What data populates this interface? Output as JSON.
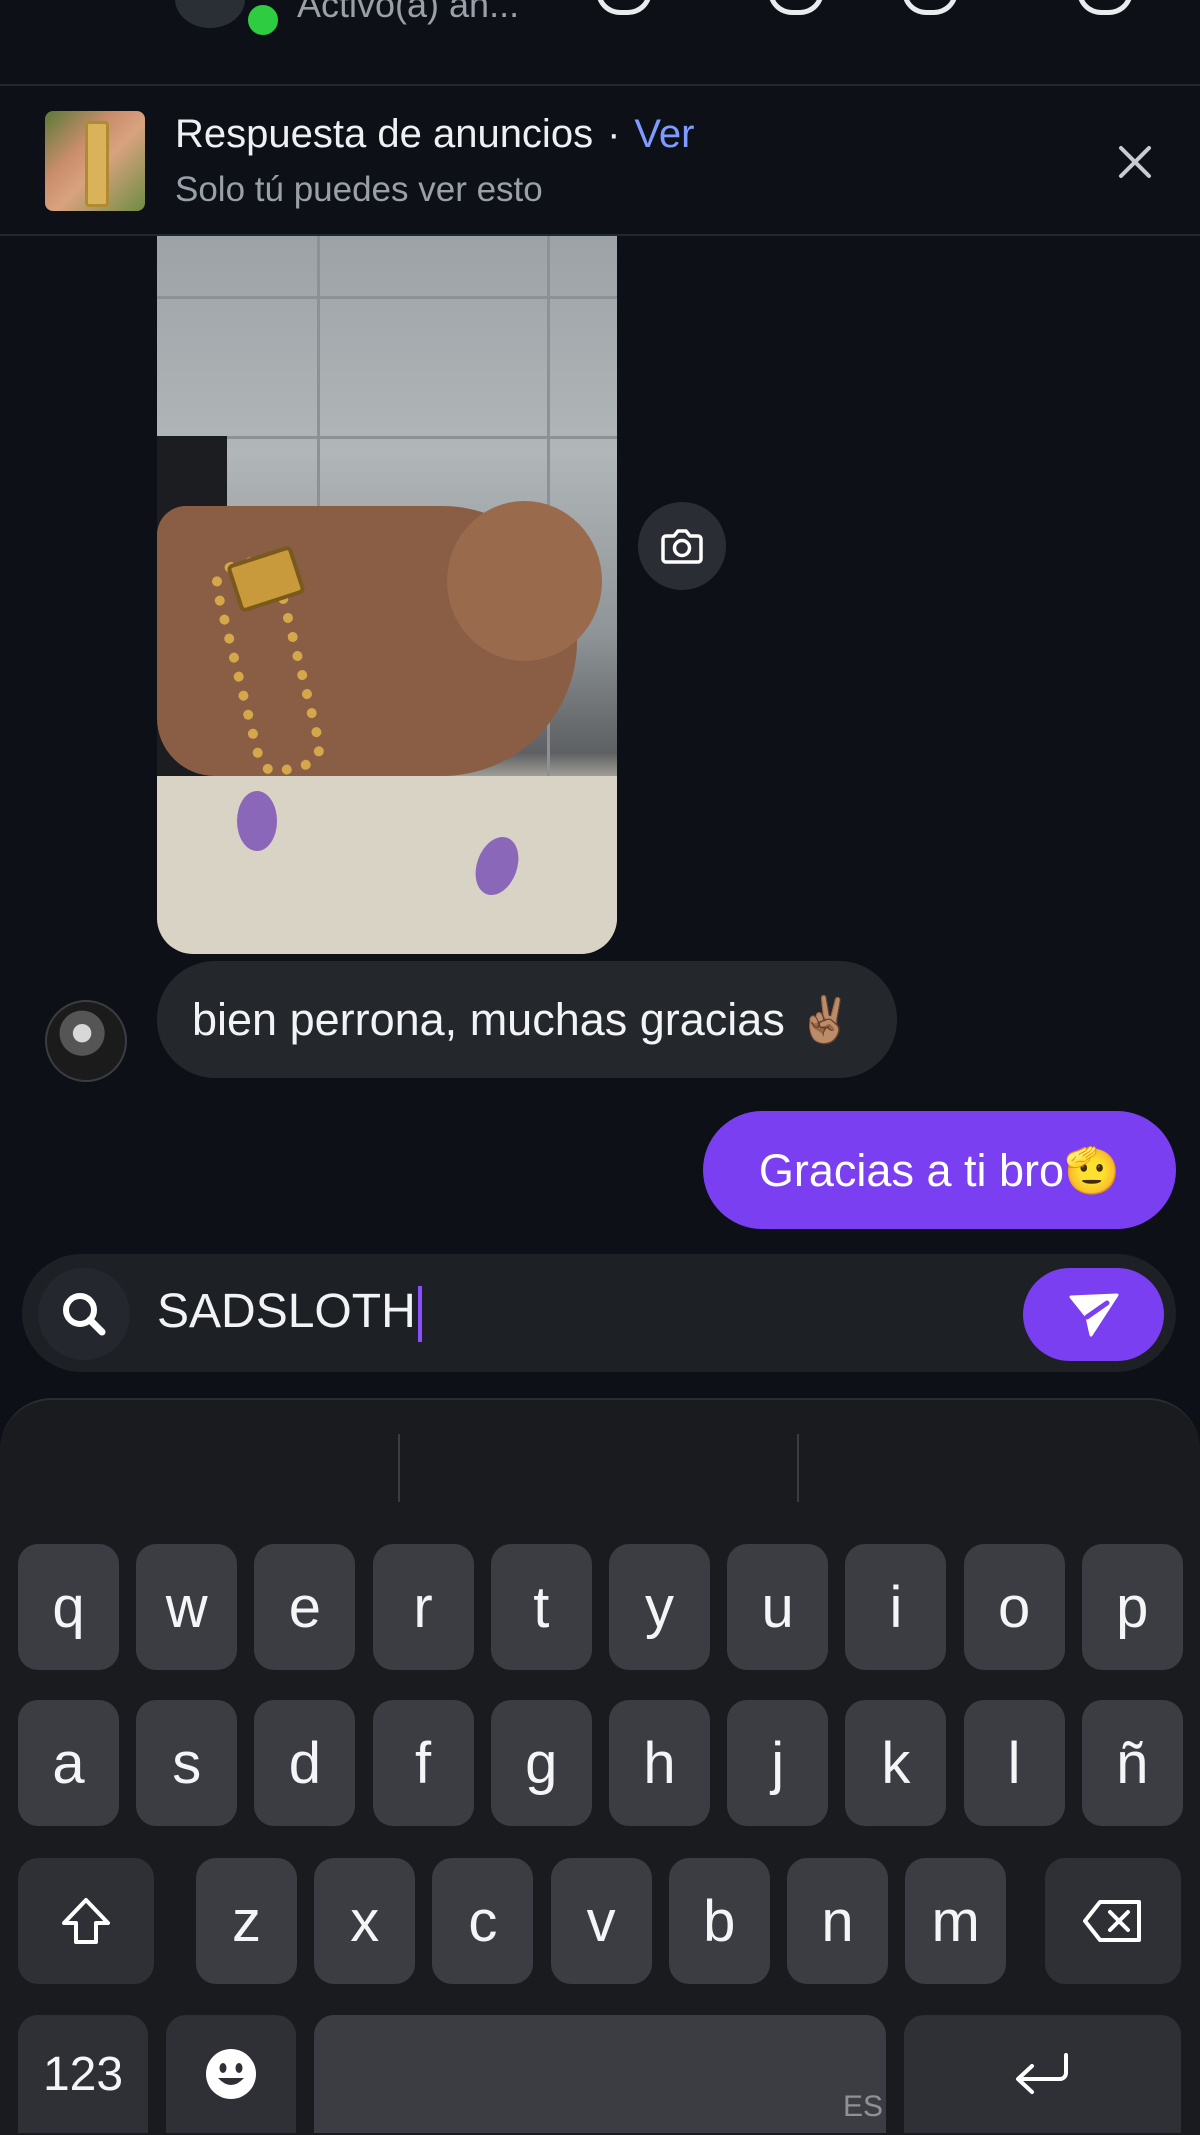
{
  "header": {
    "status": "Activo(a) ah..."
  },
  "banner": {
    "title": "Respuesta de anuncios",
    "separator": "·",
    "link": "Ver",
    "subtitle": "Solo tú puedes ver esto"
  },
  "messages": {
    "incoming": "bien perrona, muchas gracias ✌🏽",
    "outgoing": "Gracias a ti bro🫡"
  },
  "composer": {
    "value": "SADSLOTH"
  },
  "keyboard": {
    "row1": [
      "q",
      "w",
      "e",
      "r",
      "t",
      "y",
      "u",
      "i",
      "o",
      "p"
    ],
    "row2": [
      "a",
      "s",
      "d",
      "f",
      "g",
      "h",
      "j",
      "k",
      "l",
      "ñ"
    ],
    "row3": [
      "z",
      "x",
      "c",
      "v",
      "b",
      "n",
      "m"
    ],
    "numbers_label": "123",
    "language": "ES"
  },
  "colors": {
    "accent": "#7b3ff2",
    "link": "#7e9bff",
    "online": "#2ecc40",
    "background": "#0d1117"
  }
}
